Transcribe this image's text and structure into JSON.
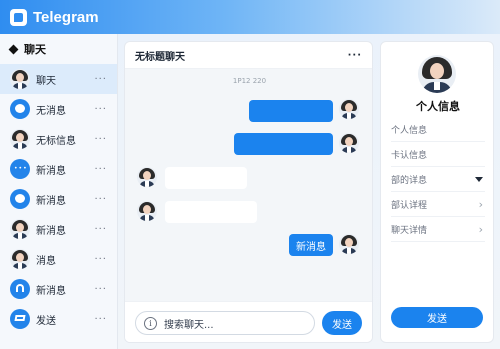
{
  "app": {
    "title": "Telegram"
  },
  "sidebar": {
    "header": "聊天",
    "items": [
      {
        "label": "聊天",
        "icon": "avatar",
        "active": true
      },
      {
        "label": "无消息",
        "icon": "chat-bubble-icon"
      },
      {
        "label": "无标信息",
        "icon": "avatar"
      },
      {
        "label": "新消息",
        "icon": "chat-dots-icon"
      },
      {
        "label": "新消息",
        "icon": "chat-bubble-icon"
      },
      {
        "label": "新消息",
        "icon": "avatar"
      },
      {
        "label": "消息",
        "icon": "avatar"
      },
      {
        "label": "新消息",
        "icon": "bell-icon"
      },
      {
        "label": "发送",
        "icon": "layers-icon"
      }
    ],
    "more_label": "···"
  },
  "chat": {
    "title": "无标题聊天",
    "more_label": "···",
    "timestamp": "1P12 220",
    "last_message": "新消息",
    "composer_placeholder": "搜索聊天...",
    "info_glyph": "i",
    "send_label": "发送"
  },
  "profile": {
    "title": "个人信息",
    "rows": [
      {
        "label": "个人信息",
        "control": "none"
      },
      {
        "label": "卡认信息",
        "control": "none"
      },
      {
        "label": "部的详息",
        "control": "dropdown"
      },
      {
        "label": "部认详程",
        "control": "chevron"
      },
      {
        "label": "聊天详情",
        "control": "chevron"
      }
    ],
    "chevron_glyph": "›",
    "send_label": "发送"
  },
  "colors": {
    "accent": "#1b83ee",
    "active_row": "#dcebfb"
  }
}
